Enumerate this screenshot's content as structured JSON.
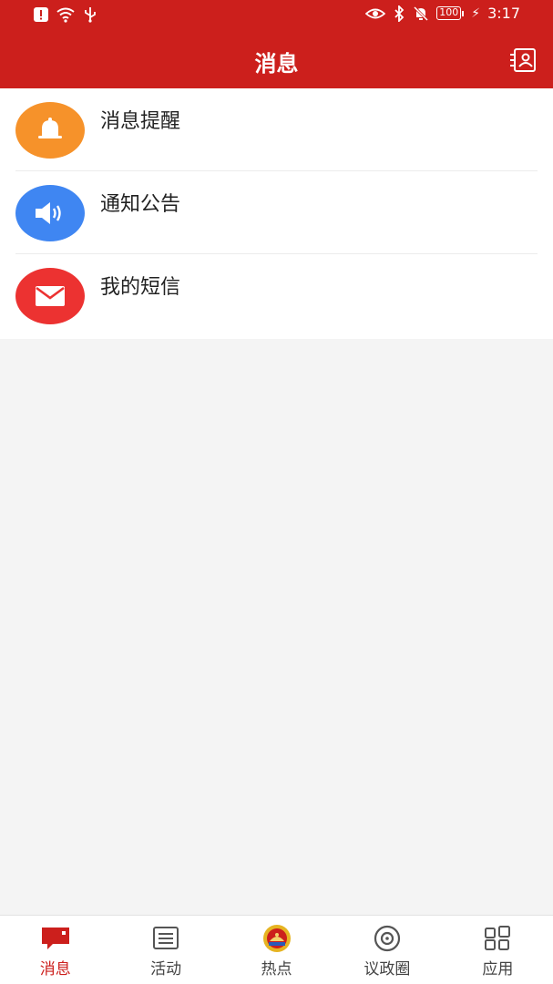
{
  "status_bar": {
    "time": "3:17",
    "battery": "100"
  },
  "header": {
    "title": "消息"
  },
  "list": {
    "items": [
      {
        "label": "消息提醒",
        "icon": "bell-icon",
        "color": "#f6922a"
      },
      {
        "label": "通知公告",
        "icon": "speaker-icon",
        "color": "#3f86f2"
      },
      {
        "label": "我的短信",
        "icon": "envelope-icon",
        "color": "#ec3231"
      }
    ]
  },
  "tabbar": {
    "active_color": "#cc1f1c",
    "tabs": [
      {
        "label": "消息",
        "icon": "message-icon",
        "active": true
      },
      {
        "label": "活动",
        "icon": "activity-list-icon",
        "active": false
      },
      {
        "label": "热点",
        "icon": "emblem-icon",
        "active": false
      },
      {
        "label": "议政圈",
        "icon": "circle-icon",
        "active": false
      },
      {
        "label": "应用",
        "icon": "apps-grid-icon",
        "active": false
      }
    ]
  }
}
